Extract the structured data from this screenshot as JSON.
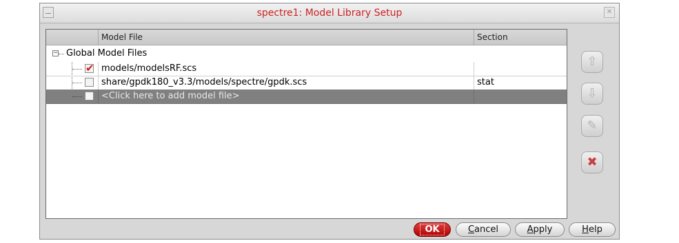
{
  "window": {
    "title": "spectre1: Model Library Setup",
    "close_glyph": "✕"
  },
  "table": {
    "columns": [
      "Model File",
      "Section"
    ],
    "root": {
      "label": "Global Model Files",
      "expander": "−"
    },
    "rows": [
      {
        "checked": true,
        "check_glyph": "✔",
        "file": "models/modelsRF.scs",
        "section": ""
      },
      {
        "checked": false,
        "check_glyph": "",
        "file": "share/gpdk180_v3.3/models/spectre/gpdk.scs",
        "section": "stat"
      },
      {
        "checked": false,
        "check_glyph": "",
        "file": "<Click here to add model file>",
        "section": "",
        "selected": true
      }
    ]
  },
  "side_buttons": [
    {
      "name": "move-up",
      "icon": "arrow-up-icon",
      "glyph": "⇧"
    },
    {
      "name": "move-down",
      "icon": "arrow-down-icon",
      "glyph": "⇩"
    },
    {
      "name": "edit",
      "icon": "edit-icon",
      "glyph": "✎"
    },
    {
      "name": "delete",
      "icon": "delete-icon",
      "glyph": "✖"
    }
  ],
  "dialog_buttons": {
    "ok": "OK",
    "cancel_prefix": "C",
    "cancel_rest": "ancel",
    "apply_prefix": "A",
    "apply_rest": "pply",
    "help_prefix": "H",
    "help_rest": "elp"
  },
  "colors": {
    "title": "#cc2222",
    "ok_button": "#c81818",
    "selected_row": "#808080",
    "check": "#d01818"
  }
}
